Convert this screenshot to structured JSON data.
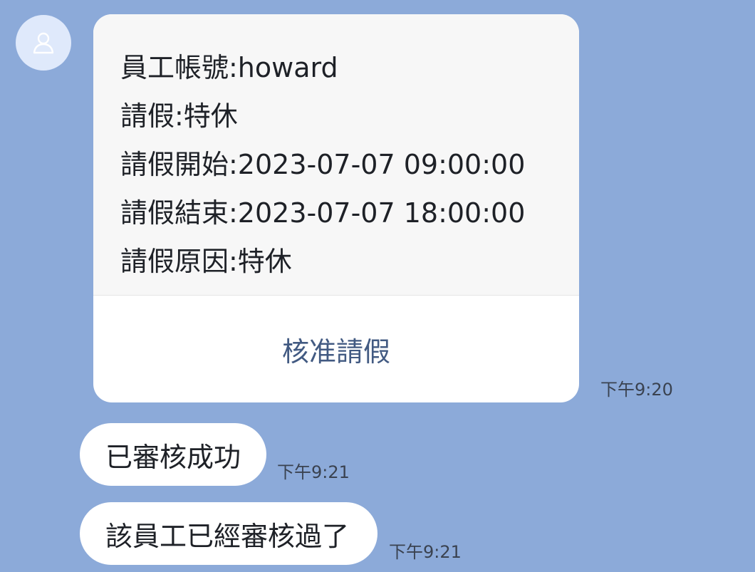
{
  "messages": [
    {
      "sender_avatar_icon": "user-icon",
      "card": {
        "lines": [
          "員工帳號:howard",
          "請假:特休",
          "請假開始:2023-07-07 09:00:00",
          "請假結束:2023-07-07 18:00:00",
          "請假原因:特休"
        ],
        "action_label": "核准請假"
      },
      "time": "下午9:20"
    },
    {
      "text": "已審核成功",
      "time": "下午9:21"
    },
    {
      "text": "該員工已經審核過了",
      "time": "下午9:21"
    }
  ],
  "colors": {
    "background": "#8caad9",
    "bubble": "#ffffff",
    "card_body": "#f7f7f7",
    "action_text": "#425a82",
    "avatar": "#dfe9fb"
  }
}
